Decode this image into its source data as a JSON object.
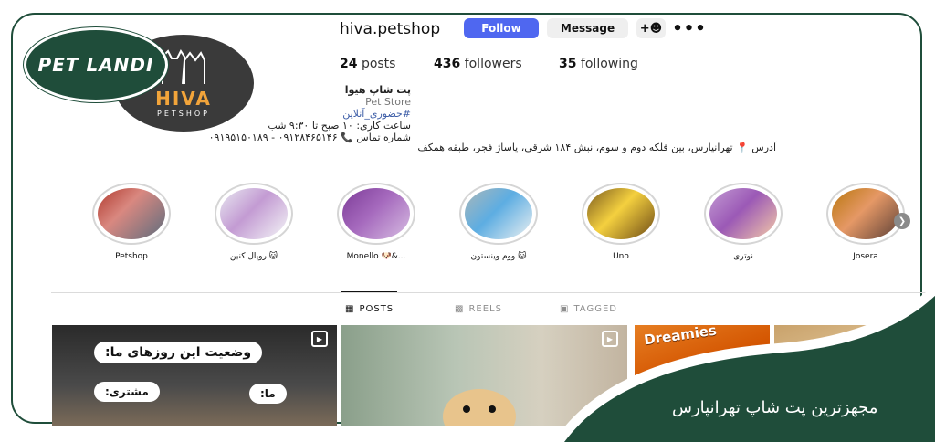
{
  "profile": {
    "username": "hiva.petshop",
    "follow_label": "Follow",
    "message_label": "Message",
    "add_user_icon": "add-user-icon",
    "more_icon": "more-icon",
    "stats": [
      {
        "value": "24",
        "label": "posts"
      },
      {
        "value": "436",
        "label": "followers"
      },
      {
        "value": "35",
        "label": "following"
      }
    ]
  },
  "logos": {
    "pet_landi": "PET LANDI",
    "hiva_name": "HIVA",
    "hiva_sub": "PETSHOP"
  },
  "bio": {
    "name": "پت شاپ هیوا",
    "category": "Pet Store",
    "tag": "#حضوری_آنلاین",
    "hours": "ساعت کاری: ۱۰ صبح تا ۹:۳۰ شب",
    "phone": "شماره تماس 📞 ۰۹۱۲۸۴۶۵۱۴۶ - ۰۹۱۹۵۱۵۰۱۸۹",
    "address": "آدرس 📍 تهرانپارس، بین فلکه دوم و سوم، نبش ۱۸۴ شرقی، پاساژ فجر، طبقه همکف"
  },
  "highlights": [
    {
      "label": "Petshop"
    },
    {
      "label": "رویال کنین 🐱"
    },
    {
      "label": "Monello 🐶&..."
    },
    {
      "label": "ووم وینستون 🐱"
    },
    {
      "label": "Uno"
    },
    {
      "label": "نوتری"
    },
    {
      "label": "Josera"
    }
  ],
  "tabs": [
    {
      "label": "POSTS",
      "icon": "grid-icon"
    },
    {
      "label": "REELS",
      "icon": "reels-icon"
    },
    {
      "label": "TAGGED",
      "icon": "tagged-icon"
    }
  ],
  "posts": {
    "p1_title": "وضعیت این روزهای ما:",
    "p1_customer": "مشتری:",
    "p1_us": "ما:",
    "p3_brand": "Dreamies"
  },
  "banner": {
    "text": "مجهزترین پت شاپ تهرانپارس"
  },
  "colors": {
    "brand_green": "#1f4d3a",
    "follow_blue": "#4f67f0",
    "hiva_orange": "#f2a43a"
  }
}
